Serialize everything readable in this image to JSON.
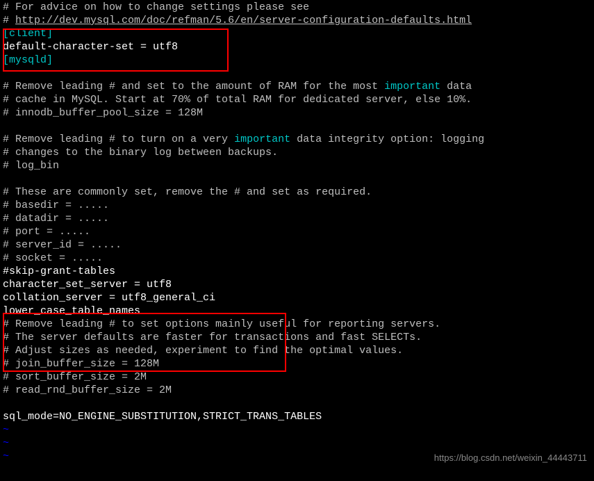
{
  "lines": {
    "l1": "# For advice on how to change settings please see",
    "l2a": "# ",
    "l2b": "http://dev.mysql.com/doc/refman/5.6/en/server-configuration-defaults.html",
    "l3": "[client]",
    "l4": "default-character-set = utf8",
    "l5": "[mysqld]",
    "l6": "",
    "l7a": "# Remove leading # and set to the amount of RAM for the most ",
    "l7b": "important",
    "l7c": " data",
    "l8": "# cache in MySQL. Start at 70% of total RAM for dedicated server, else 10%.",
    "l9": "# innodb_buffer_pool_size = 128M",
    "l10": "",
    "l11a": "# Remove leading # to turn on a very ",
    "l11b": "important",
    "l11c": " data integrity option: logging",
    "l12": "# changes to the binary log between backups.",
    "l13": "# log_bin",
    "l14": "",
    "l15": "# These are commonly set, remove the # and set as required.",
    "l16": "# basedir = .....",
    "l17": "# datadir = .....",
    "l18": "# port = .....",
    "l19": "# server_id = .....",
    "l20": "# socket = .....",
    "l21": "#skip-grant-tables",
    "l22": "character_set_server = utf8",
    "l23": "collation_server = utf8_general_ci",
    "l24": "lower_case_table_names",
    "l25": "# Remove leading # to set options mainly useful for reporting servers.",
    "l26": "# The server defaults are faster for transactions and fast SELECTs.",
    "l27": "# Adjust sizes as needed, experiment to find the optimal values.",
    "l28": "# join_buffer_size = 128M",
    "l29": "# sort_buffer_size = 2M",
    "l30": "# read_rnd_buffer_size = 2M",
    "l31": "",
    "l32": "sql_mode=NO_ENGINE_SUBSTITUTION,STRICT_TRANS_TABLES",
    "tilde": "~"
  },
  "watermark": "https://blog.csdn.net/weixin_44443711"
}
